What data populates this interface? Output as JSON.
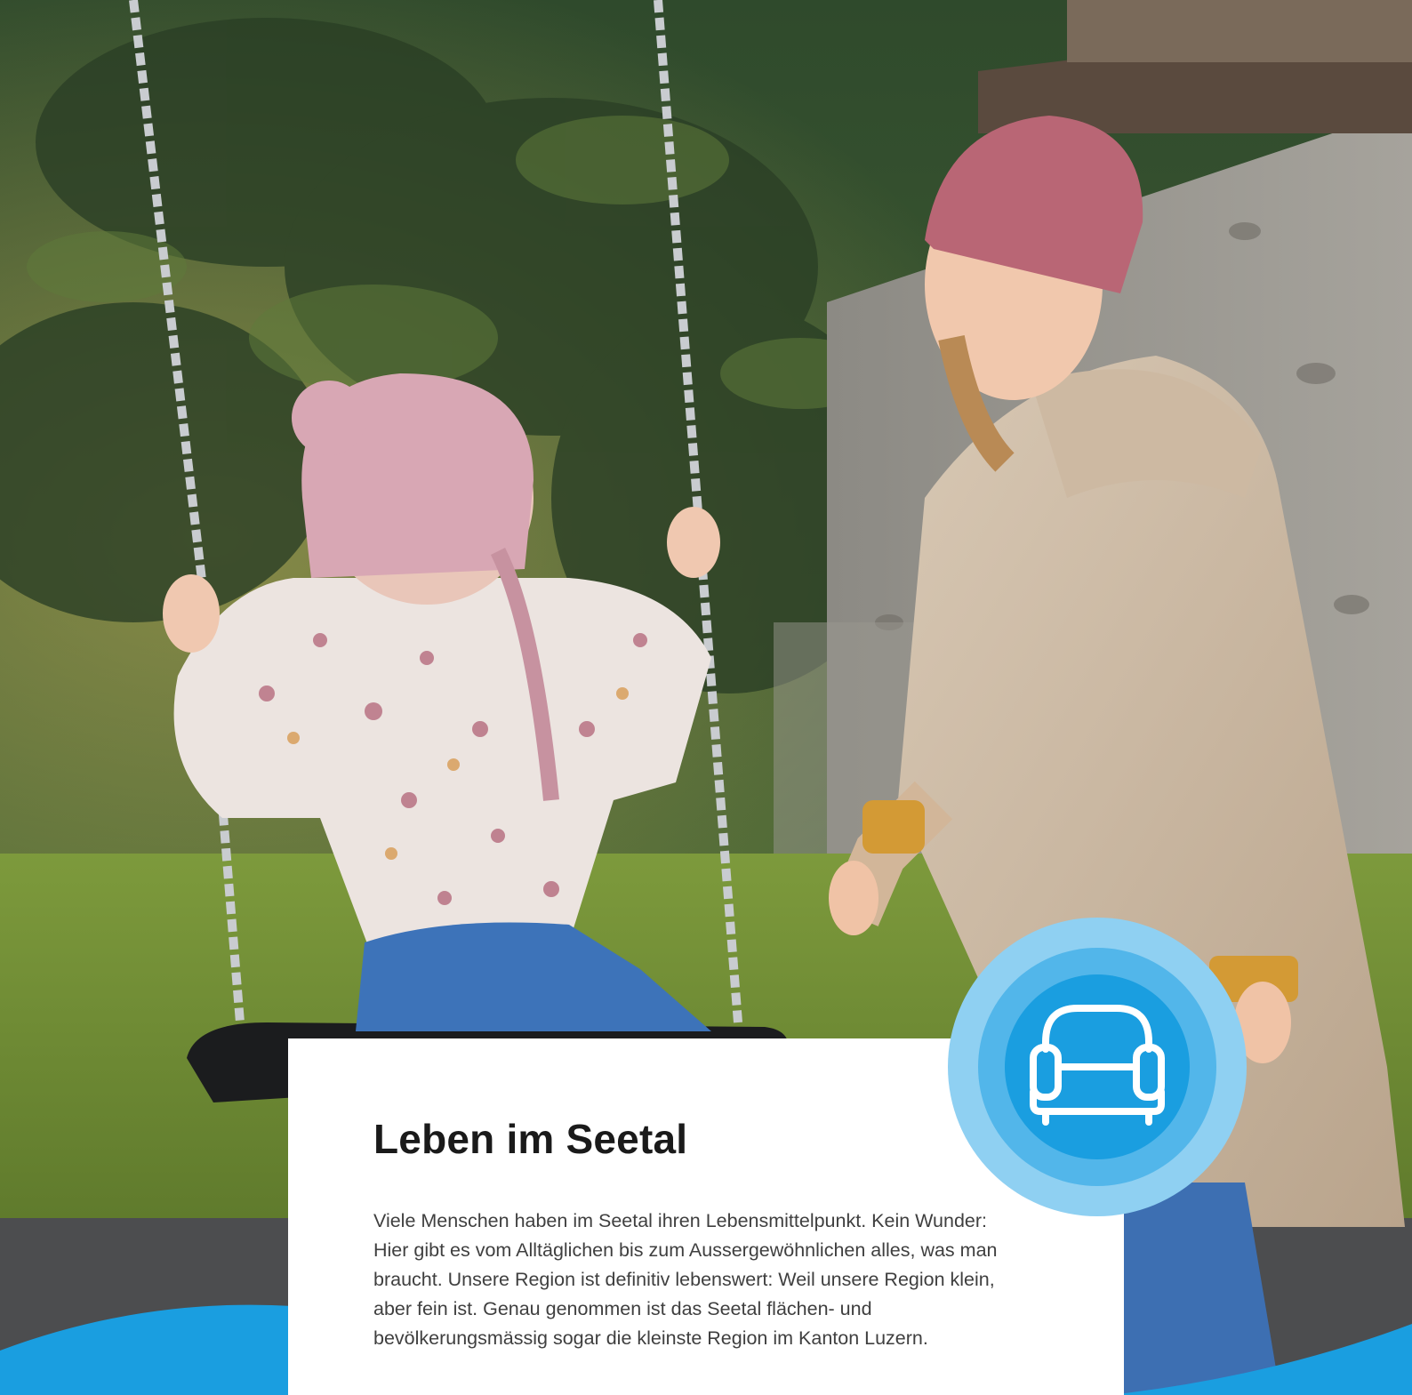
{
  "section": {
    "title": "Leben im Seetal",
    "body": "Viele Menschen haben im Seetal ihren Lebensmittelpunkt. Kein Wunder: Hier gibt es vom Alltäglichen bis zum Aussergewöhnlichen alles, was man braucht. Unsere Region ist definitiv lebenswert: Weil unsere Region klein, aber fein ist. Genau genommen ist das Seetal flächen- und bevölkerungsmässig sogar die kleinste Region im Kanton Luzern."
  },
  "badge": {
    "icon": "armchair-icon"
  },
  "colors": {
    "accent_blue": "#1a9ee0",
    "accent_light": "#8fd0f2",
    "accent_mid": "#52b6ea"
  }
}
